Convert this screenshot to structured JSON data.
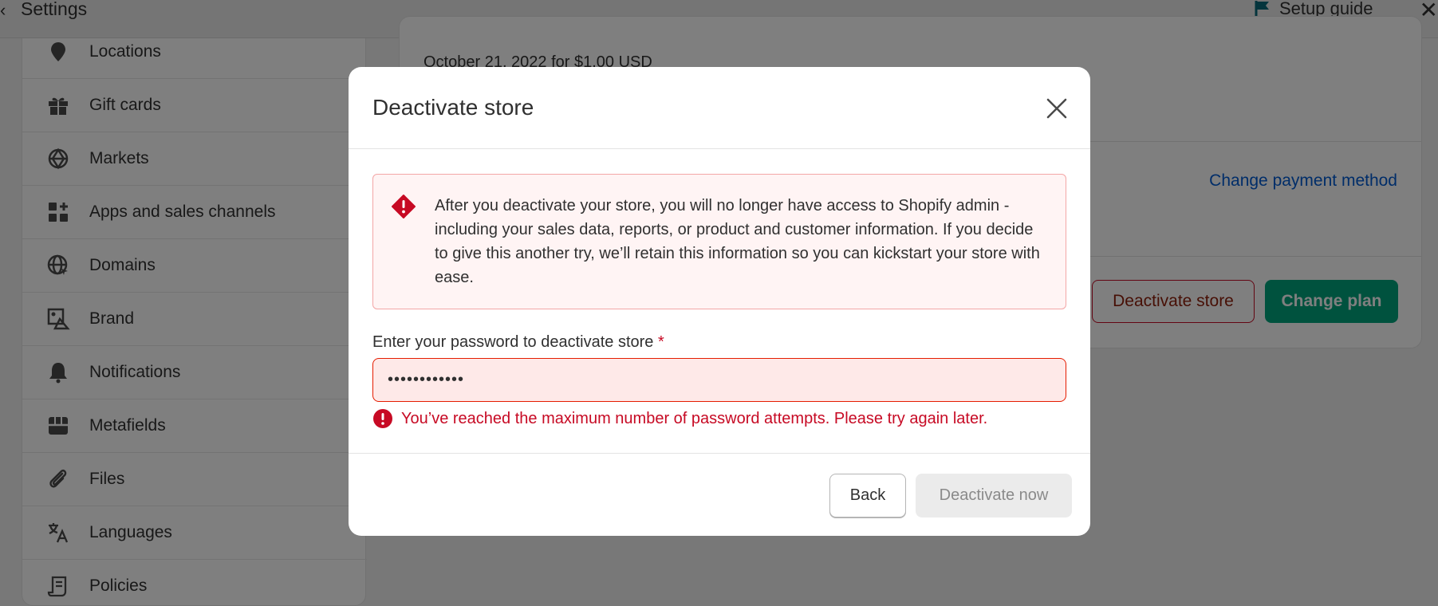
{
  "topbar": {
    "title": "Settings",
    "setup_guide": "Setup guide"
  },
  "sidebar": {
    "items": [
      {
        "label": "Locations",
        "icon": "location-pin-icon"
      },
      {
        "label": "Gift cards",
        "icon": "gift-icon"
      },
      {
        "label": "Markets",
        "icon": "globe-markets-icon"
      },
      {
        "label": "Apps and sales channels",
        "icon": "apps-icon"
      },
      {
        "label": "Domains",
        "icon": "domain-globe-icon"
      },
      {
        "label": "Brand",
        "icon": "brand-icon"
      },
      {
        "label": "Notifications",
        "icon": "bell-icon"
      },
      {
        "label": "Metafields",
        "icon": "metafields-icon"
      },
      {
        "label": "Files",
        "icon": "paperclip-icon"
      },
      {
        "label": "Languages",
        "icon": "translate-icon"
      },
      {
        "label": "Policies",
        "icon": "scroll-icon"
      }
    ]
  },
  "main": {
    "billing_line": "October 21, 2022 for $1.00 USD",
    "change_payment": "Change payment method",
    "deactivate_store": "Deactivate store",
    "change_plan": "Change plan"
  },
  "modal": {
    "title": "Deactivate store",
    "banner_text": "After you deactivate your store, you will no longer have access to Shopify admin - including your sales data, reports, or product and customer information. If you decide to give this another try, we’ll retain this information so you can kickstart your store with ease.",
    "password_label": "Enter your password to deactivate store",
    "required_marker": "*",
    "password_value": "••••••••••••",
    "error_text": "You’ve reached the maximum number of password attempts. Please try again later.",
    "back_label": "Back",
    "deactivate_now_label": "Deactivate now"
  },
  "colors": {
    "critical": "#c70a24",
    "primary": "#00a47c",
    "link": "#005bd3"
  }
}
